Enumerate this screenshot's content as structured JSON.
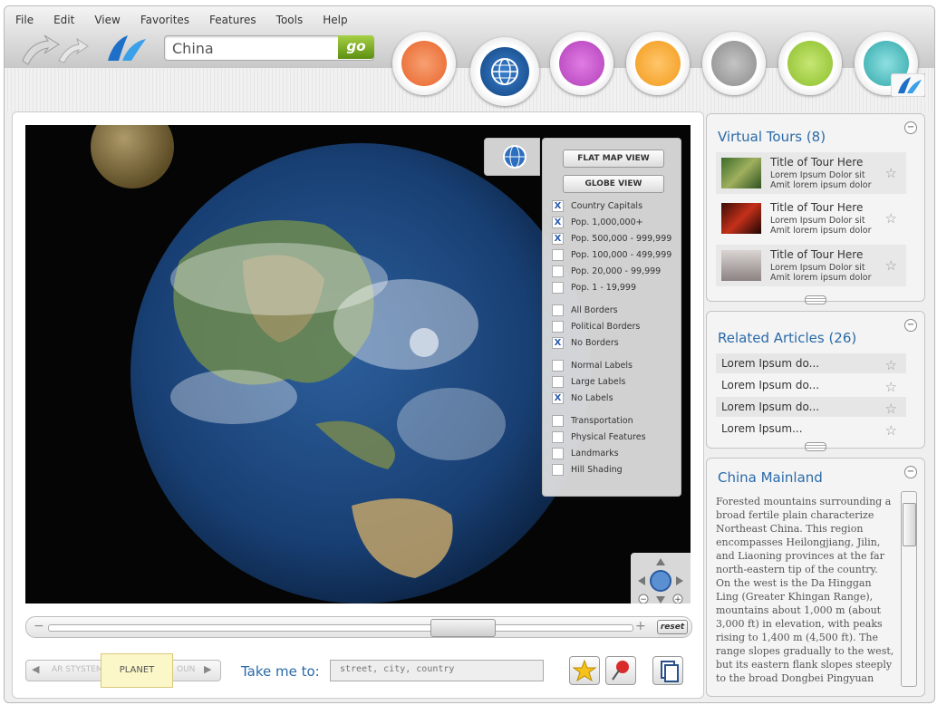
{
  "menu": [
    "File",
    "Edit",
    "View",
    "Favorites",
    "Features",
    "Tools",
    "Help"
  ],
  "search": {
    "value": "China",
    "go_label": "go"
  },
  "nav": [
    {
      "name": "shop-icon",
      "color": "#e8642a"
    },
    {
      "name": "globe-icon",
      "color": "#1d5fa6"
    },
    {
      "name": "photos-icon",
      "color": "#b23fb8"
    },
    {
      "name": "camera-icon",
      "color": "#f29a1a"
    },
    {
      "name": "stars-icon",
      "color": "#8b8b8b"
    },
    {
      "name": "folder-icon",
      "color": "#8abf2a"
    },
    {
      "name": "hand-icon",
      "color": "#2fa7a9"
    }
  ],
  "layers": {
    "flat_map_label": "FLAT MAP VIEW",
    "globe_view_label": "GLOBE VIEW",
    "options": [
      {
        "label": "Country Capitals",
        "checked": true
      },
      {
        "label": "Pop. 1,000,000+",
        "checked": true
      },
      {
        "label": "Pop. 500,000 - 999,999",
        "checked": true
      },
      {
        "label": "Pop. 100,000 - 499,999",
        "checked": false
      },
      {
        "label": "Pop. 20,000 - 99,999",
        "checked": false
      },
      {
        "label": "Pop. 1 - 19,999",
        "checked": false
      },
      {
        "label": "All Borders",
        "checked": false
      },
      {
        "label": "Political Borders",
        "checked": false
      },
      {
        "label": "No Borders",
        "checked": true
      },
      {
        "label": "Normal Labels",
        "checked": false
      },
      {
        "label": "Large Labels",
        "checked": false
      },
      {
        "label": "No Labels",
        "checked": true
      },
      {
        "label": "Transportation",
        "checked": false
      },
      {
        "label": "Physical Features",
        "checked": false
      },
      {
        "label": "Landmarks",
        "checked": false
      },
      {
        "label": "Hill Shading",
        "checked": false
      }
    ],
    "check_mark": "X"
  },
  "zoom": {
    "minus": "−",
    "plus": "+",
    "reset_label": "reset"
  },
  "scope": {
    "prev": "AR STYSTEM",
    "current": "PLANET",
    "next": "OUN"
  },
  "takeme": {
    "label": "Take me to:",
    "placeholder": "street, city, country"
  },
  "virtual_tours": {
    "title": "Virtual Tours (8)",
    "items": [
      {
        "title": "Title of Tour Here",
        "line1": "Lorem Ipsum Dolor sit",
        "line2": "Amit lorem ipsum dolor"
      },
      {
        "title": "Title of Tour Here",
        "line1": "Lorem Ipsum Dolor sit",
        "line2": "Amit lorem ipsum dolor"
      },
      {
        "title": "Title of Tour Here",
        "line1": "Lorem Ipsum Dolor sit",
        "line2": "Amit lorem ipsum dolor"
      }
    ]
  },
  "related_articles": {
    "title": "Related Articles (26)",
    "items": [
      "Lorem Ipsum do...",
      "Lorem Ipsum do...",
      "Lorem Ipsum do...",
      "Lorem Ipsum..."
    ]
  },
  "china": {
    "title": "China Mainland",
    "text": "Forested mountains surrounding a broad fertile plain characterize Northeast China. This region encompasses Heilongjiang, Jilin, and Liaoning provinces at the far north-eastern tip of the country. On the west is the Da Hinggan Ling (Greater Khingan Range), mountains about 1,000 m (about 3,000 ft) in elevation, with peaks rising to 1,400 m (4,500 ft). The range slopes gradually to the west, but its eastern flank slopes steeply to the broad Dongbei Pingyuan (Northeast China"
  },
  "star_glyph": "☆"
}
